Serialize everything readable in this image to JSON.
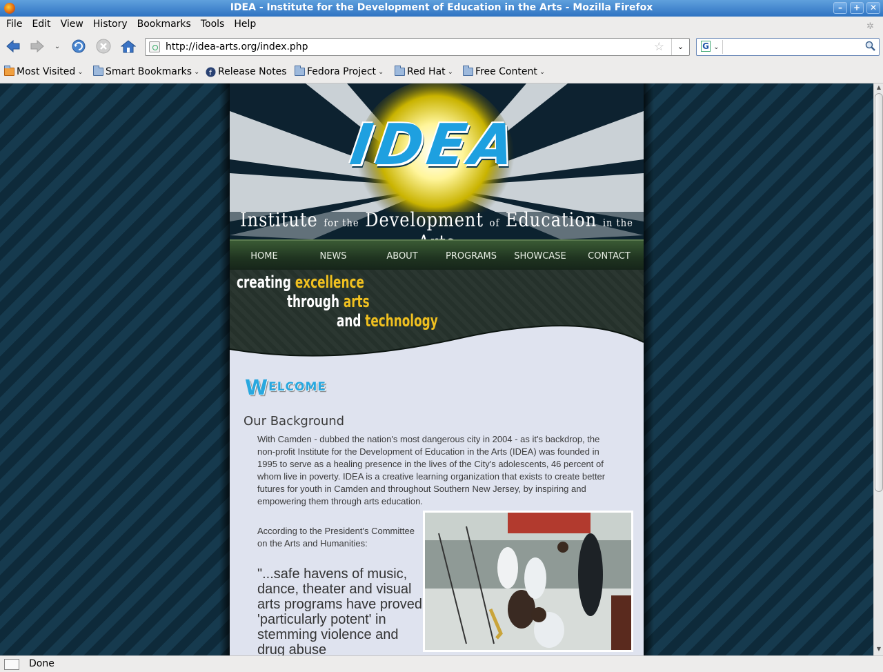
{
  "window": {
    "title": "IDEA - Institute for the Development of Education in the Arts - Mozilla Firefox",
    "buttons": [
      "–",
      "+",
      "✕"
    ]
  },
  "menu": [
    "File",
    "Edit",
    "View",
    "History",
    "Bookmarks",
    "Tools",
    "Help"
  ],
  "url": "http://idea-arts.org/index.php",
  "search": {
    "value": "",
    "engine_label": "G"
  },
  "bookmarks": [
    {
      "label": "Most Visited",
      "icon": "rss-folder-icon"
    },
    {
      "label": "Smart Bookmarks",
      "icon": "folder-icon"
    },
    {
      "label": "Release Notes",
      "icon": "fedora-icon"
    },
    {
      "label": "Fedora Project",
      "icon": "folder-icon"
    },
    {
      "label": "Red Hat",
      "icon": "folder-icon"
    },
    {
      "label": "Free Content",
      "icon": "folder-icon"
    }
  ],
  "site": {
    "logo": "IDEA",
    "tagline": {
      "w1": "Institute",
      "w2": "for the",
      "w3": "Development",
      "w4": "of",
      "w5": "Education",
      "w6": "in the",
      "w7": "Arts"
    },
    "nav": [
      "HOME",
      "NEWS",
      "ABOUT",
      "PROGRAMS",
      "SHOWCASE",
      "CONTACT"
    ],
    "slogan": {
      "a": "creating",
      "b": "excellence",
      "c": "through",
      "d": "arts",
      "e": "and",
      "f": "technology"
    },
    "welcome": {
      "first": "W",
      "rest": "ELCOME"
    },
    "heading": "Our Background",
    "paragraph1": "With Camden - dubbed the nation's most dangerous city in 2004 - as it's backdrop, the non-profit Institute for the Development of Education in the Arts (IDEA) was founded in 1995 to serve as a healing presence in the lives of the City's adolescents, 46 percent of whom live in poverty. IDEA is a creative learning organization that exists to create better futures for youth in Camden and throughout Southern New Jersey, by inspiring and empowering them through arts education.",
    "paragraph2": "According to the President's Committee on the Arts and Humanities:",
    "quote": "\"...safe havens of music, dance, theater and visual arts programs have proved 'particularly potent' in stemming violence and drug abuse"
  },
  "status": "Done",
  "colors": {
    "titlebar": "#2f73c2",
    "nav_green": "#1f3420",
    "accent_blue": "#29a8df",
    "accent_gold": "#f0c020",
    "page_bg": "#dfe3ef"
  }
}
